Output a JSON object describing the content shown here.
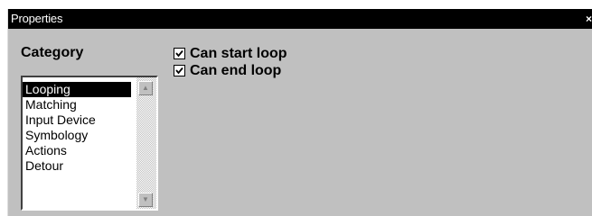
{
  "window": {
    "title": "Properties",
    "close_glyph": "×"
  },
  "category": {
    "label": "Category",
    "items": [
      {
        "label": "Looping",
        "selected": true
      },
      {
        "label": "Matching",
        "selected": false
      },
      {
        "label": "Input Device",
        "selected": false
      },
      {
        "label": "Symbology",
        "selected": false
      },
      {
        "label": "Actions",
        "selected": false
      },
      {
        "label": "Detour",
        "selected": false
      }
    ],
    "scroll_up_icon": "scroll-up-arrow-icon",
    "scroll_down_icon": "scroll-down-arrow-icon"
  },
  "options": [
    {
      "label": "Can start loop",
      "checked": true
    },
    {
      "label": "Can end loop",
      "checked": true
    }
  ]
}
